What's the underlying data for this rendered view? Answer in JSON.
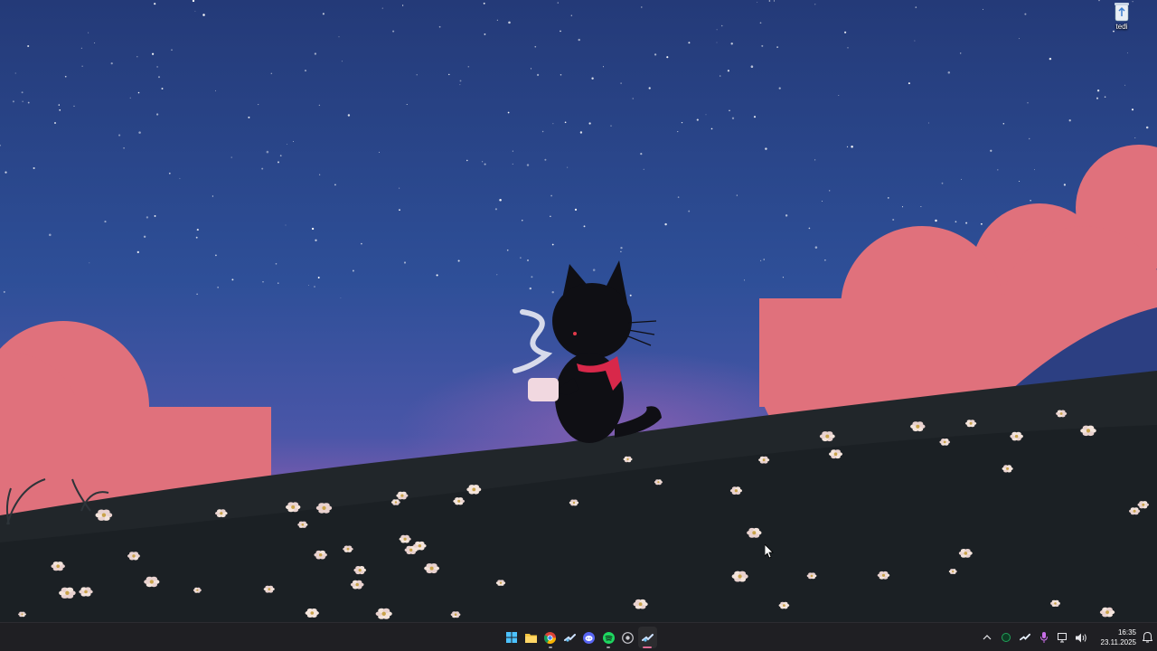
{
  "desktop": {
    "icons": [
      {
        "label": "tedi",
        "icon": "recycle-bin-icon"
      }
    ],
    "wallpaper": "night-sky-black-cat-meadow"
  },
  "taskbar": {
    "apps": [
      {
        "name": "Start",
        "icon": "windows-start-icon",
        "running": false,
        "active": false
      },
      {
        "name": "File Explorer",
        "icon": "folder-icon",
        "running": false,
        "active": false
      },
      {
        "name": "Google Chrome",
        "icon": "chrome-icon",
        "running": true,
        "active": false
      },
      {
        "name": "Steam",
        "icon": "steam-icon",
        "running": false,
        "active": false
      },
      {
        "name": "Discord",
        "icon": "discord-icon",
        "running": false,
        "active": false
      },
      {
        "name": "Spotify",
        "icon": "spotify-icon",
        "running": true,
        "active": false
      },
      {
        "name": "GitHub",
        "icon": "github-icon",
        "running": false,
        "active": false
      },
      {
        "name": "Steam",
        "icon": "steam-icon",
        "running": true,
        "active": true
      }
    ],
    "tray": {
      "icons": [
        "chevron-up-icon",
        "nvidia-icon",
        "steam-icon",
        "microphone-icon",
        "network-icon",
        "volume-icon"
      ],
      "time": "16:35",
      "date": "23.11.2025",
      "notification_icon": "notification-bell-icon"
    },
    "colors": {
      "background": "#1f1f23",
      "active_indicator": "#e06b93"
    }
  }
}
